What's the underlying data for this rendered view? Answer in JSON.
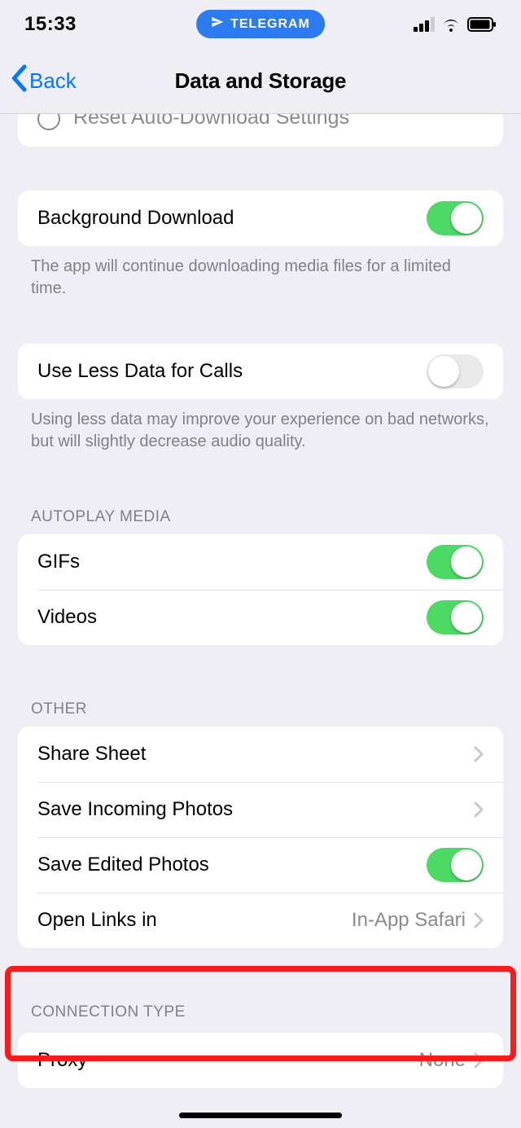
{
  "status": {
    "time": "15:33",
    "pill_app": "TELEGRAM"
  },
  "nav": {
    "back_label": "Back",
    "title": "Data and Storage"
  },
  "reset_row": {
    "label": "Reset Auto-Download Settings"
  },
  "background_download": {
    "label": "Background Download",
    "enabled": true,
    "footer": "The app will continue downloading media files for a limited time."
  },
  "less_data": {
    "label": "Use Less Data for Calls",
    "enabled": false,
    "footer": "Using less data may improve your experience on bad networks, but will slightly decrease audio quality."
  },
  "autoplay": {
    "header": "AUTOPLAY MEDIA",
    "gifs": {
      "label": "GIFs",
      "enabled": true
    },
    "videos": {
      "label": "Videos",
      "enabled": true
    }
  },
  "other": {
    "header": "OTHER",
    "share_sheet": {
      "label": "Share Sheet"
    },
    "save_incoming": {
      "label": "Save Incoming Photos"
    },
    "save_edited": {
      "label": "Save Edited Photos",
      "enabled": true
    },
    "open_links": {
      "label": "Open Links in",
      "value": "In-App Safari"
    }
  },
  "connection": {
    "header": "CONNECTION TYPE",
    "proxy": {
      "label": "Proxy",
      "value": "None"
    }
  }
}
